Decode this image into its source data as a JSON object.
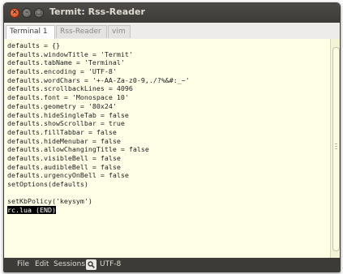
{
  "window": {
    "title": "Termit: Rss-Reader"
  },
  "tabs": [
    {
      "label": "Terminal 1",
      "active": true
    },
    {
      "label": "Rss-Reader",
      "active": false
    },
    {
      "label": "vim",
      "active": false
    }
  ],
  "terminal": {
    "lines": [
      "defaults = {}",
      "defaults.windowTitle = 'Termit'",
      "defaults.tabName = 'Terminal'",
      "defaults.encoding = 'UTF-8'",
      "defaults.wordChars = '+-AA-Za-z0-9,./?%&#:_~'",
      "defaults.scrollbackLines = 4096",
      "defaults.font = 'Monospace 10'",
      "defaults.geometry = '80x24'",
      "defaults.hideSingleTab = false",
      "defaults.showScrollbar = true",
      "defaults.fillTabbar = false",
      "defaults.hideMenubar = false",
      "defaults.allowChangingTitle = false",
      "defaults.visibleBell = false",
      "defaults.audibleBell = false",
      "defaults.urgencyOnBell = false",
      "setOptions(defaults)",
      "",
      "setKbPolicy('keysym')",
      "rc.lua (END)"
    ],
    "highlighted_line": "rc.lua (END)"
  },
  "menubar": {
    "items": [
      "File",
      "Edit",
      "Sessions"
    ],
    "search_icon": "search-icon",
    "encoding": "UTF-8"
  },
  "colors": {
    "titlebar": "#3c3b37",
    "terminal_bg": "#ffffe8",
    "close_button": "#e0501b"
  }
}
